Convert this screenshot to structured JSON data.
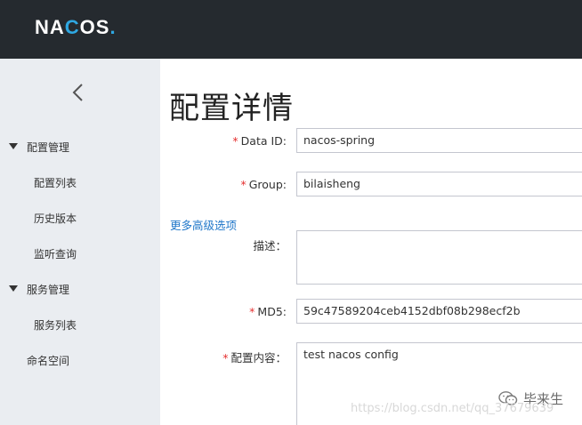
{
  "header": {
    "logo_text": "NACOS.",
    "logo_accent_color": "#2fa8e2",
    "background": "#252a2f"
  },
  "sidebar": {
    "collapse_icon": "chevron-left-icon",
    "groups": [
      {
        "label": "配置管理",
        "items": [
          "配置列表",
          "历史版本",
          "监听查询"
        ]
      },
      {
        "label": "服务管理",
        "items": [
          "服务列表"
        ]
      }
    ],
    "standalone": "命名空间"
  },
  "main": {
    "title": "配置详情",
    "required_mark": "*",
    "fields": {
      "data_id": {
        "label": "Data ID:",
        "value": "nacos-spring"
      },
      "group": {
        "label": "Group:",
        "value": "bilaisheng"
      },
      "advanced_link": "更多高级选项",
      "description": {
        "label": "描述：",
        "value": ""
      },
      "md5": {
        "label": "MD5:",
        "value": "59c47589204ceb4152dbf08b298ecf2b"
      },
      "content": {
        "label": "配置内容：",
        "value": "test nacos config"
      }
    }
  },
  "watermark": {
    "url": "https://blog.csdn.net/qq_37679639",
    "brand": "毕来生"
  }
}
